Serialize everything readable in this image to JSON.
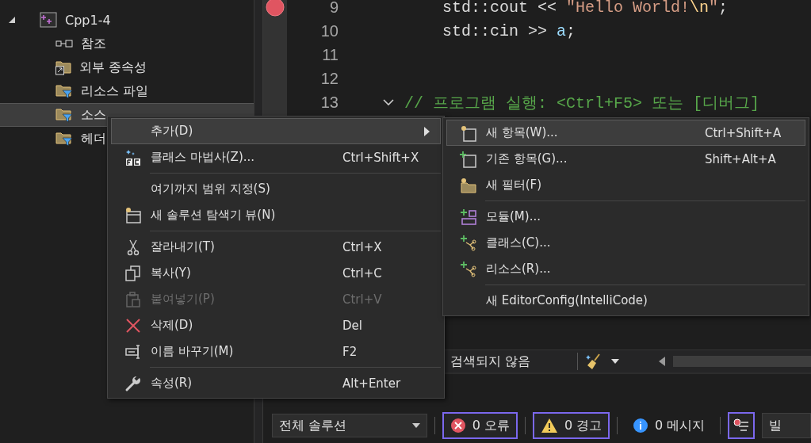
{
  "solution_explorer": {
    "items": [
      {
        "label": "Cpp1-4",
        "kind": "project",
        "expanded": true,
        "selected": false,
        "children": [
          {
            "label": "참조",
            "kind": "references",
            "selected": false
          },
          {
            "label": "외부 종속성",
            "kind": "external",
            "selected": false
          },
          {
            "label": "리소스 파일",
            "kind": "filter",
            "selected": false
          },
          {
            "label": "소스",
            "kind": "filter",
            "selected": true
          },
          {
            "label": "헤더",
            "kind": "filter",
            "selected": false
          }
        ]
      }
    ]
  },
  "editor": {
    "lines": [
      {
        "number": "9",
        "breakpoint": true,
        "tokens": [
          {
            "text": "    std::cout << ",
            "kind": "plain"
          },
          {
            "text": "\"Hello World!",
            "kind": "string"
          },
          {
            "text": "\\n",
            "kind": "escape"
          },
          {
            "text": "\"",
            "kind": "string"
          },
          {
            "text": ";",
            "kind": "plain"
          }
        ]
      },
      {
        "number": "10",
        "tokens": [
          {
            "text": "    std::cin >> ",
            "kind": "plain"
          },
          {
            "text": "a",
            "kind": "variable"
          },
          {
            "text": ";",
            "kind": "plain"
          }
        ]
      },
      {
        "number": "11"
      },
      {
        "number": "12"
      },
      {
        "number": "13",
        "foldable": true,
        "tokens": [
          {
            "text": "// 프로그램 실행: <Ctrl+F5> 또는 [디버그]",
            "kind": "comment"
          }
        ]
      }
    ],
    "status": {
      "search_result": "검색되지 않음"
    }
  },
  "error_list": {
    "scope": "전체 솔루션",
    "filters": [
      {
        "kind": "error",
        "label": "0 오류",
        "selected": true
      },
      {
        "kind": "warning",
        "label": "0 경고",
        "selected": true
      },
      {
        "kind": "message",
        "label": "0 메시지",
        "selected": false
      }
    ],
    "build_filter_selected": true,
    "source": "빌"
  },
  "context_menu": {
    "items": [
      {
        "kind": "item",
        "label": "추가(D)",
        "disabled": false,
        "selected": true,
        "submenu": true
      },
      {
        "kind": "item",
        "label": "클래스 마법사(Z)...",
        "shortcut": "Ctrl+Shift+X",
        "disabled": false,
        "selected": false,
        "submenu": false
      },
      {
        "kind": "separator"
      },
      {
        "kind": "item",
        "label": "여기까지 범위 지정(S)",
        "disabled": false,
        "selected": false,
        "submenu": false
      },
      {
        "kind": "item",
        "label": "새 솔루션 탐색기 뷰(N)",
        "disabled": false,
        "selected": false,
        "submenu": false
      },
      {
        "kind": "separator"
      },
      {
        "kind": "item",
        "label": "잘라내기(T)",
        "shortcut": "Ctrl+X",
        "disabled": false,
        "selected": false,
        "submenu": false
      },
      {
        "kind": "item",
        "label": "복사(Y)",
        "shortcut": "Ctrl+C",
        "disabled": false,
        "selected": false,
        "submenu": false
      },
      {
        "kind": "item",
        "label": "붙여넣기(P)",
        "shortcut": "Ctrl+V",
        "disabled": true,
        "selected": false,
        "submenu": false
      },
      {
        "kind": "item",
        "label": "삭제(D)",
        "shortcut": "Del",
        "disabled": false,
        "selected": false,
        "submenu": false
      },
      {
        "kind": "item",
        "label": "이름 바꾸기(M)",
        "shortcut": "F2",
        "disabled": false,
        "selected": false,
        "submenu": false
      },
      {
        "kind": "separator"
      },
      {
        "kind": "item",
        "label": "속성(R)",
        "shortcut": "Alt+Enter",
        "disabled": false,
        "selected": false,
        "submenu": false
      }
    ]
  },
  "submenu": {
    "items": [
      {
        "kind": "item",
        "label": "새 항목(W)...",
        "shortcut": "Ctrl+Shift+A",
        "disabled": false,
        "selected": true,
        "submenu": false
      },
      {
        "kind": "item",
        "label": "기존 항목(G)...",
        "shortcut": "Shift+Alt+A",
        "disabled": false,
        "selected": false,
        "submenu": false
      },
      {
        "kind": "item",
        "label": "새 필터(F)",
        "disabled": false,
        "selected": false,
        "submenu": false
      },
      {
        "kind": "separator"
      },
      {
        "kind": "item",
        "label": "모듈(M)...",
        "disabled": false,
        "selected": false,
        "submenu": false
      },
      {
        "kind": "item",
        "label": "클래스(C)...",
        "disabled": false,
        "selected": false,
        "submenu": false
      },
      {
        "kind": "item",
        "label": "리소스(R)...",
        "disabled": false,
        "selected": false,
        "submenu": false
      },
      {
        "kind": "separator"
      },
      {
        "kind": "item",
        "label": "새 EditorConfig(IntelliCode)",
        "disabled": false,
        "selected": false,
        "submenu": false
      }
    ]
  }
}
